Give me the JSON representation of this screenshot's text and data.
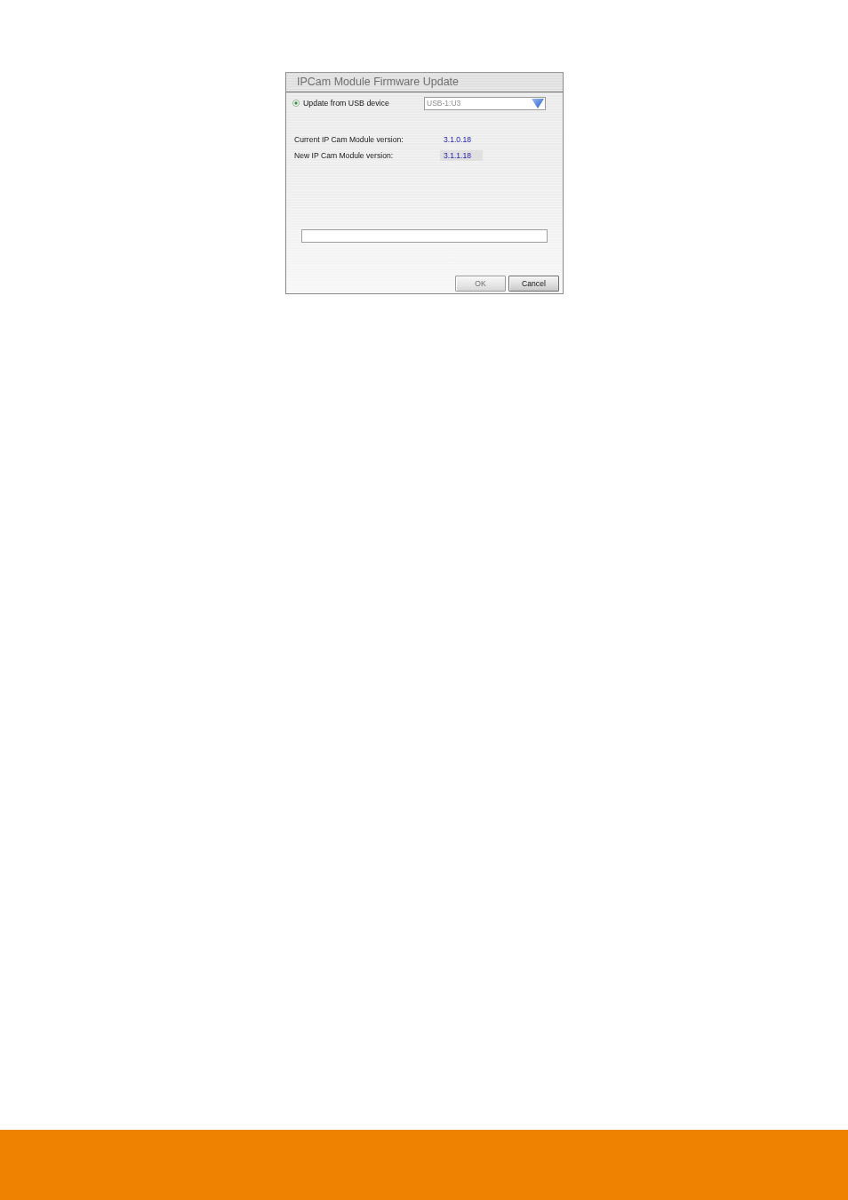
{
  "dialog": {
    "title": "IPCam Module Firmware Update",
    "source_option": {
      "label": "Update from USB device",
      "selected": true
    },
    "device_select": {
      "value": "USB-1:U3",
      "disabled": true
    },
    "versions": [
      {
        "label": "Current IP Cam Module version:",
        "value": "3.1.0.18",
        "highlighted": false
      },
      {
        "label": "New IP Cam Module version:",
        "value": "3.1.1.18",
        "highlighted": true
      }
    ],
    "progress": {
      "level": 0
    },
    "buttons": [
      {
        "label": "OK",
        "disabled": true
      },
      {
        "label": "Cancel",
        "disabled": false
      }
    ]
  }
}
